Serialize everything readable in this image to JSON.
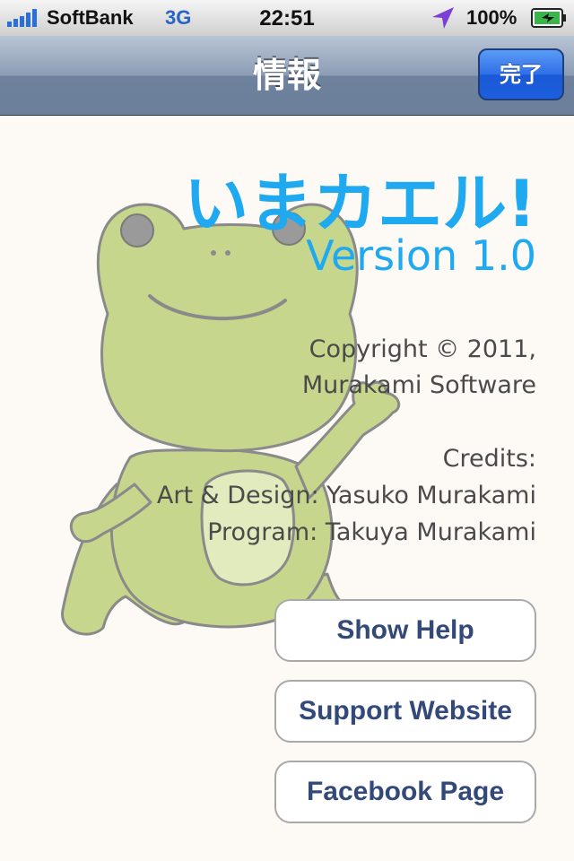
{
  "status_bar": {
    "carrier": "SoftBank",
    "network": "3G",
    "time": "22:51",
    "battery": "100%",
    "icons": [
      "signal-bars-icon",
      "location-arrow-icon",
      "battery-charging-icon"
    ]
  },
  "nav": {
    "title": "情報",
    "done_label": "完了"
  },
  "about": {
    "app_name": "いまカエル!",
    "version": "Version 1.0",
    "copyright_line1": "Copyright © 2011,",
    "copyright_line2": "Murakami Software",
    "credits_heading": "Credits:",
    "credit_art": "Art & Design: Yasuko Murakami",
    "credit_program": "Program: Takuya Murakami"
  },
  "buttons": {
    "show_help": "Show Help",
    "support_website": "Support Website",
    "facebook_page": "Facebook Page"
  },
  "colors": {
    "accent": "#1ea9f0",
    "button_text": "#32497a",
    "frog_green": "#c6d68c",
    "frog_belly": "#e2ebbd",
    "done_button": "#2f6fe8"
  }
}
